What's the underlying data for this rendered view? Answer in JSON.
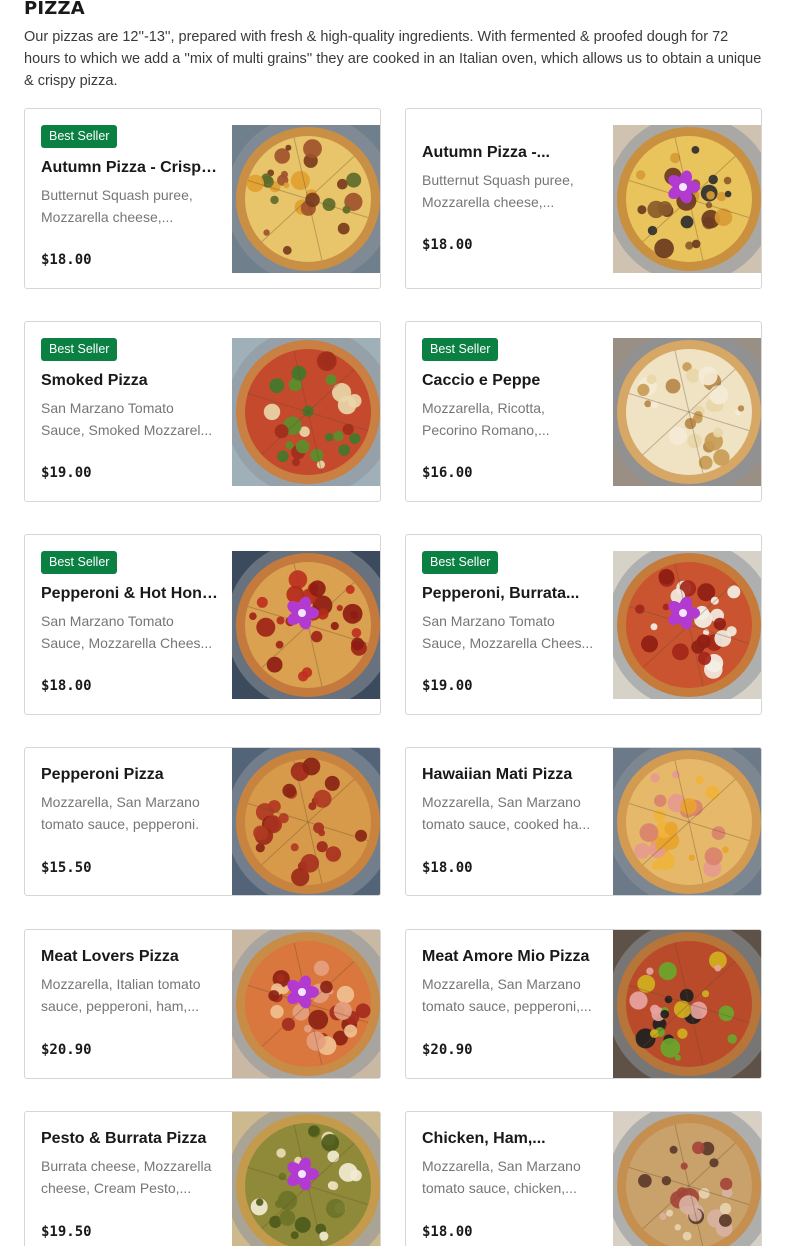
{
  "section": {
    "title": "PIZZA",
    "description": "Our pizzas are 12''-13'', prepared with fresh & high-quality ingredients. With fermented & proofed dough for 72 hours to which we add a ''mix of multi grains'' they are cooked in an Italian oven, which allows us to obtain a unique & crispy pizza."
  },
  "badge_label": "Best Seller",
  "colors": {
    "badge": "#0b8043",
    "border": "#d6d6d6",
    "muted_text": "#767676"
  },
  "items": [
    {
      "name": "Autumn Pizza - Crispy...",
      "description": "Butternut Squash puree, Mozzarella cheese,...",
      "price": "$18.00",
      "best_seller": true,
      "image": "pizza-photo-autumn"
    },
    {
      "name": "Autumn Pizza -...",
      "description": "Butternut Squash puree, Mozzarella cheese,...",
      "price": "$18.00",
      "best_seller": false,
      "image": "pizza-photo-autumn-orchid"
    },
    {
      "name": "Smoked Pizza",
      "description": "San Marzano Tomato Sauce, Smoked Mozzarel...",
      "price": "$19.00",
      "best_seller": true,
      "image": "pizza-photo-smoked"
    },
    {
      "name": "Caccio e Peppe",
      "description": "Mozzarella, Ricotta, Pecorino Romano,...",
      "price": "$16.00",
      "best_seller": true,
      "image": "pizza-photo-white"
    },
    {
      "name": "Pepperoni & Hot Honey",
      "description": "San Marzano Tomato Sauce, Mozzarella Chees...",
      "price": "$18.00",
      "best_seller": true,
      "image": "pizza-photo-pepperoni-orchid"
    },
    {
      "name": "Pepperoni, Burrata...",
      "description": "San Marzano Tomato Sauce, Mozzarella Chees...",
      "price": "$19.00",
      "best_seller": true,
      "image": "pizza-photo-burrata"
    },
    {
      "name": "Pepperoni Pizza",
      "description": "Mozzarella, San Marzano tomato sauce, pepperoni.",
      "price": "$15.50",
      "best_seller": false,
      "image": "pizza-photo-pepperoni"
    },
    {
      "name": "Hawaiian Mati Pizza",
      "description": "Mozzarella, San Marzano tomato sauce, cooked ha...",
      "price": "$18.00",
      "best_seller": false,
      "image": "pizza-photo-hawaiian"
    },
    {
      "name": "Meat Lovers Pizza",
      "description": "Mozzarella, Italian tomato sauce, pepperoni, ham,...",
      "price": "$20.90",
      "best_seller": false,
      "image": "pizza-photo-meat-lovers"
    },
    {
      "name": "Meat Amore Mio Pizza",
      "description": "Mozzarella, San Marzano tomato sauce, pepperoni,...",
      "price": "$20.90",
      "best_seller": false,
      "image": "pizza-photo-supreme"
    },
    {
      "name": "Pesto & Burrata Pizza",
      "description": "Burrata cheese, Mozzarella cheese, Cream Pesto,...",
      "price": "$19.50",
      "best_seller": false,
      "image": "pizza-photo-pesto"
    },
    {
      "name": "Chicken, Ham,...",
      "description": "Mozzarella, San Marzano tomato sauce, chicken,...",
      "price": "$18.00",
      "best_seller": false,
      "image": "pizza-photo-chicken"
    }
  ]
}
